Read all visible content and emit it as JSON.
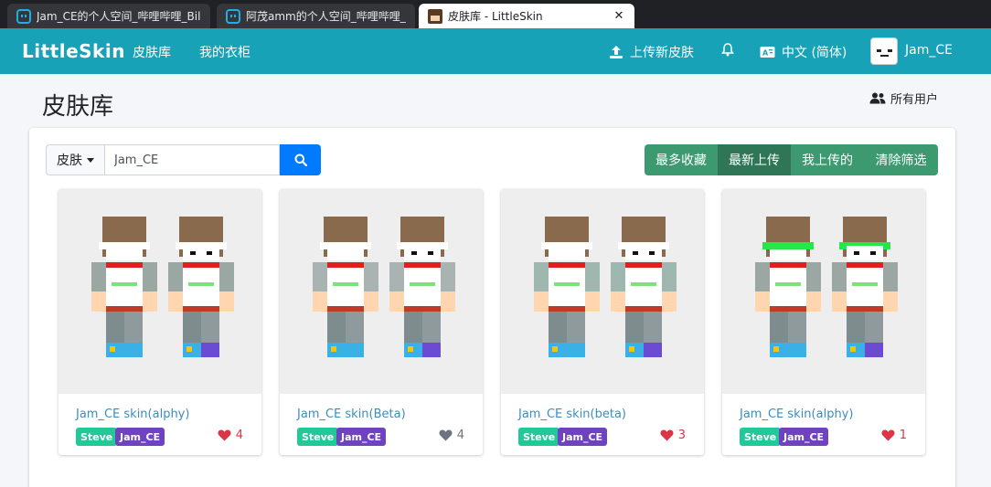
{
  "browser": {
    "tabs": [
      {
        "title": "Jam_CE的个人空间_哔哩哔哩_Bilil",
        "icon": "bilibili-icon",
        "active": false
      },
      {
        "title": "阿茂amm的个人空间_哔哩哔哩_B",
        "icon": "bilibili-icon",
        "active": false
      },
      {
        "title": "皮肤库 - LittleSkin",
        "icon": "littleskin-icon",
        "active": true,
        "close": "✕"
      }
    ]
  },
  "navbar": {
    "brand": "LittleSkin",
    "links": [
      "皮肤库",
      "我的衣柜"
    ],
    "upload": "上传新皮肤",
    "language": "中文 (简体)",
    "username": "Jam_CE",
    "color": "#17a2b8"
  },
  "header": {
    "title": "皮肤库",
    "all_users": "所有用户"
  },
  "filter": {
    "type_label": "皮肤",
    "search_value": "Jam_CE"
  },
  "sort": {
    "buttons": [
      "最多收藏",
      "最新上传",
      "我上传的",
      "清除筛选"
    ],
    "active": "最新上传"
  },
  "skins": [
    {
      "name": "Jam_CE skin(alphy)",
      "model": "Steve",
      "uploader": "Jam_CE",
      "likes": "4",
      "liked": true
    },
    {
      "name": "Jam_CE skin(Beta)",
      "model": "Steve",
      "uploader": "Jam_CE",
      "likes": "4",
      "liked": false
    },
    {
      "name": "Jam_CE skin(beta)",
      "model": "Steve",
      "uploader": "Jam_CE",
      "likes": "3",
      "liked": true
    },
    {
      "name": "Jam_CE skin(alphy)",
      "model": "Steve",
      "uploader": "Jam_CE",
      "likes": "1",
      "liked": true
    }
  ],
  "colors": {
    "liked": "#dc3545",
    "unliked": "#6c757d",
    "sort_button": "#3d9970",
    "sort_active": "#2e7656",
    "search_button": "#007bff"
  }
}
